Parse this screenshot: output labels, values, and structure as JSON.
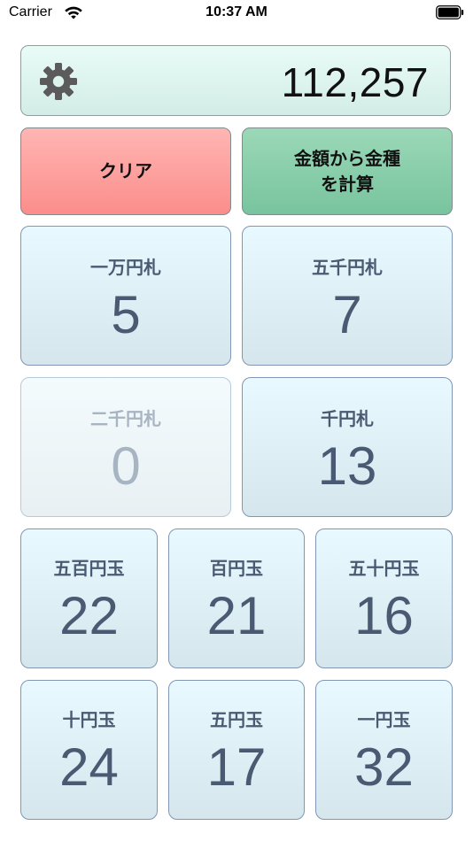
{
  "status_bar": {
    "carrier": "Carrier",
    "time": "10:37 AM"
  },
  "total": {
    "value": "112,257",
    "settings_icon": "gear-icon"
  },
  "actions": {
    "clear_label": "クリア",
    "calc_label": "金額から金種\nを計算"
  },
  "denominations": [
    {
      "label": "一万円札",
      "count": "5"
    },
    {
      "label": "五千円札",
      "count": "7"
    },
    {
      "label": "二千円札",
      "count": "0"
    },
    {
      "label": "千円札",
      "count": "13"
    },
    {
      "label": "五百円玉",
      "count": "22"
    },
    {
      "label": "百円玉",
      "count": "21"
    },
    {
      "label": "五十円玉",
      "count": "16"
    },
    {
      "label": "十円玉",
      "count": "24"
    },
    {
      "label": "五円玉",
      "count": "17"
    },
    {
      "label": "一円玉",
      "count": "32"
    }
  ],
  "colors": {
    "total_bg": "#dff5ef",
    "clear_bg": "#fb9d9a",
    "calc_bg": "#85cca7",
    "tile_text": "#4a5a72",
    "tile_disabled_text": "#a7b4c2"
  }
}
